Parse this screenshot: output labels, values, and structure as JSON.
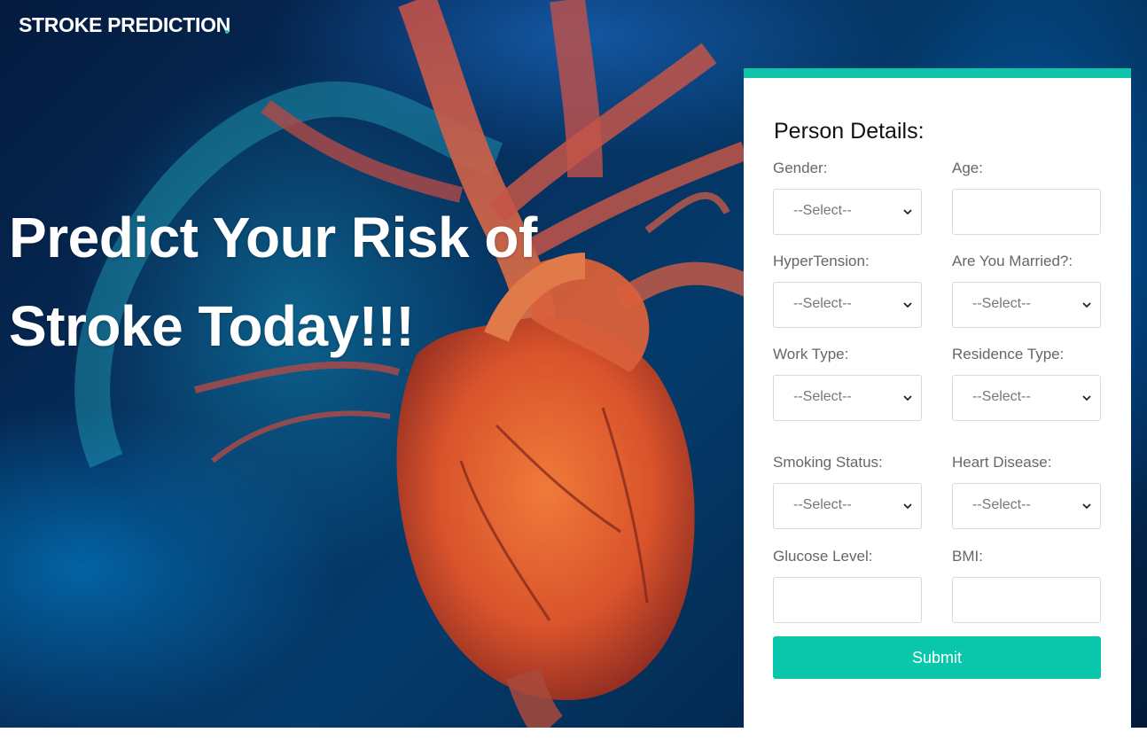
{
  "brand": {
    "title": "STROKE PREDICTION"
  },
  "hero": {
    "line1": "Predict Your Risk of",
    "line2": "Stroke Today!!!"
  },
  "form": {
    "title": "Person Details:",
    "fields": [
      {
        "label": "Gender:",
        "type": "select",
        "value": "--Select--"
      },
      {
        "label": "Age:",
        "type": "input",
        "value": ""
      },
      {
        "label": "HyperTension:",
        "type": "select",
        "value": "--Select--"
      },
      {
        "label": "Are You Married?:",
        "type": "select",
        "value": "--Select--"
      },
      {
        "label": "Work Type:",
        "type": "select",
        "value": "--Select--"
      },
      {
        "label": "Residence Type:",
        "type": "select",
        "value": "--Select--"
      },
      {
        "label": "Smoking Status:",
        "type": "select",
        "value": "--Select--"
      },
      {
        "label": "Heart Disease:",
        "type": "select",
        "value": "--Select--"
      },
      {
        "label": "Glucose Level:",
        "type": "input",
        "value": ""
      },
      {
        "label": "BMI:",
        "type": "input",
        "value": ""
      }
    ],
    "submit_label": "Submit"
  },
  "colors": {
    "accent": "#0ac6aa",
    "hero_bg": "#06305e"
  }
}
